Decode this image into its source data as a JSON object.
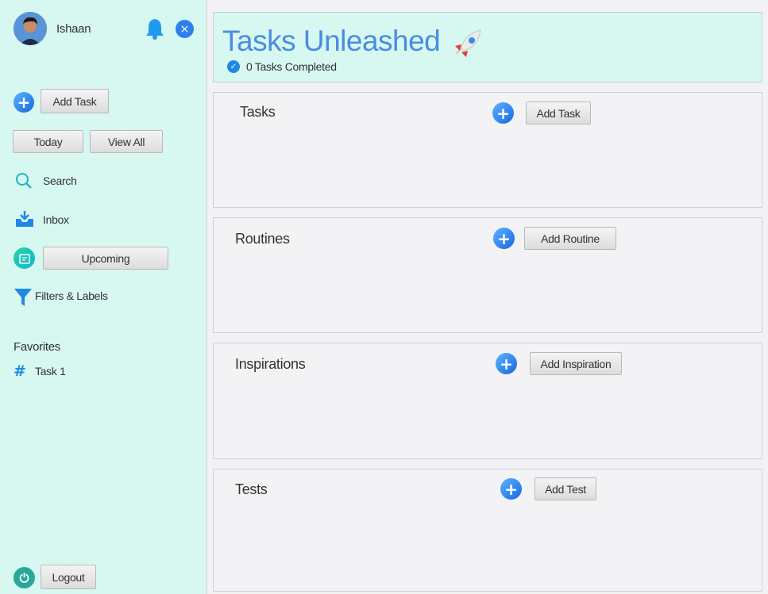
{
  "user": {
    "name": "Ishaan"
  },
  "sidebar": {
    "add_task_label": "Add Task",
    "today_label": "Today",
    "view_all_label": "View All",
    "search_label": "Search",
    "inbox_label": "Inbox",
    "upcoming_label": "Upcoming",
    "filters_label": "Filters & Labels",
    "favorites_heading": "Favorites",
    "favorites": [
      {
        "label": "Task 1"
      }
    ],
    "logout_label": "Logout"
  },
  "header": {
    "title": "Tasks Unleashed",
    "completed_text": "0 Tasks Completed"
  },
  "sections": [
    {
      "title": "Tasks",
      "button_label": "Add Task"
    },
    {
      "title": "Routines",
      "button_label": "Add Routine"
    },
    {
      "title": "Inspirations",
      "button_label": "Add Inspiration"
    },
    {
      "title": "Tests",
      "button_label": "Add Test"
    }
  ],
  "colors": {
    "sidebar_bg": "#d7f7f1",
    "accent_blue": "#1e88e5",
    "title_blue": "#4a8de0",
    "panel_bg": "#f3f3f5"
  }
}
